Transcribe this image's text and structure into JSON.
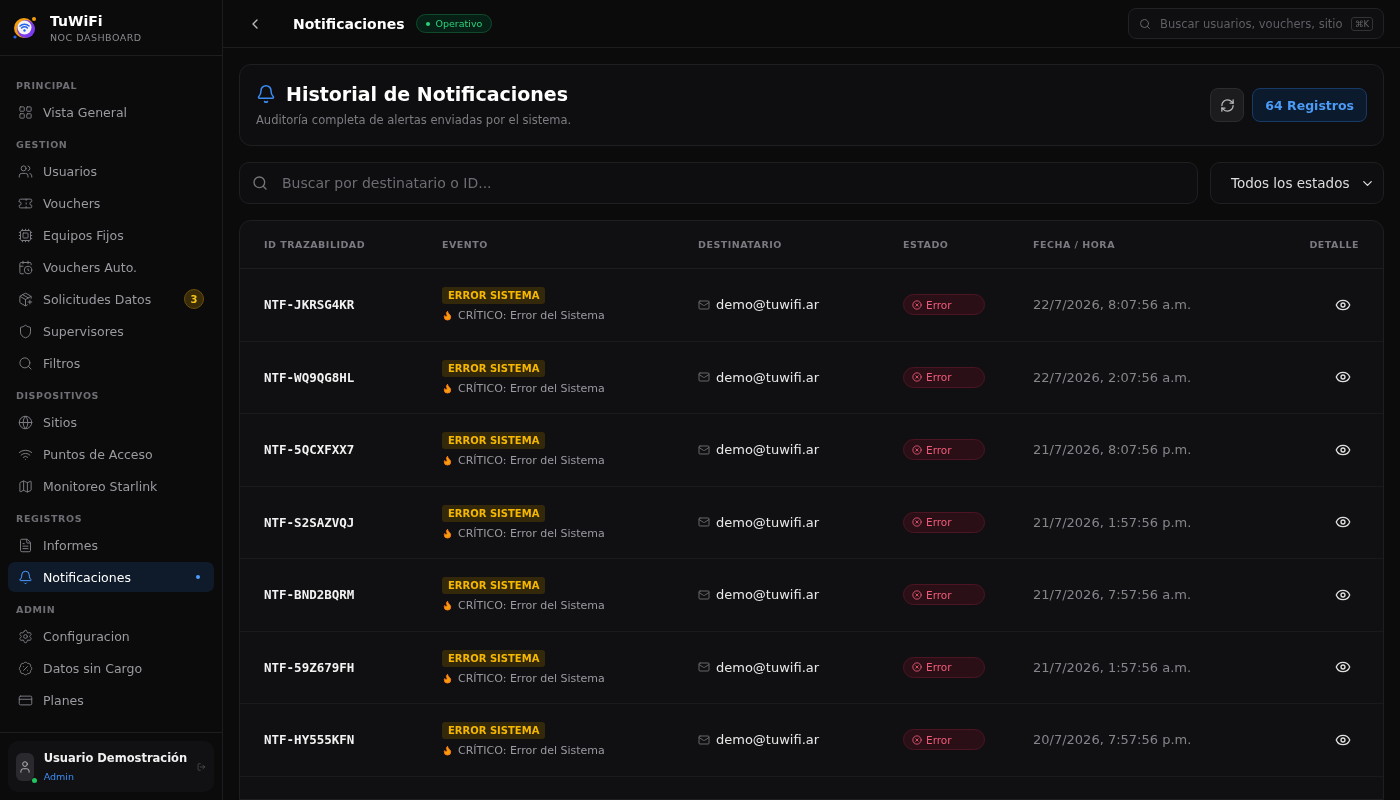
{
  "brand": {
    "name": "TuWiFi",
    "subtitle": "NOC DASHBOARD"
  },
  "sidebar": {
    "sections": [
      {
        "title": "PRINCIPAL",
        "items": [
          {
            "label": "Vista General",
            "selected": false
          }
        ]
      },
      {
        "title": "GESTION",
        "items": [
          {
            "label": "Usuarios",
            "selected": false
          },
          {
            "label": "Vouchers",
            "selected": false
          },
          {
            "label": "Equipos Fijos",
            "selected": false
          },
          {
            "label": "Vouchers Auto.",
            "selected": false
          },
          {
            "label": "Solicitudes Datos",
            "selected": false,
            "badge": "3"
          },
          {
            "label": "Supervisores",
            "selected": false
          },
          {
            "label": "Filtros",
            "selected": false
          }
        ]
      },
      {
        "title": "DISPOSITIVOS",
        "items": [
          {
            "label": "Sitios",
            "selected": false
          },
          {
            "label": "Puntos de Acceso",
            "selected": false
          },
          {
            "label": "Monitoreo Starlink",
            "selected": false
          }
        ]
      },
      {
        "title": "REGISTROS",
        "items": [
          {
            "label": "Informes",
            "selected": false
          },
          {
            "label": "Notificaciones",
            "selected": true
          }
        ]
      },
      {
        "title": "ADMIN",
        "items": [
          {
            "label": "Configuracion",
            "selected": false
          },
          {
            "label": "Datos sin Cargo",
            "selected": false
          },
          {
            "label": "Planes",
            "selected": false
          }
        ]
      }
    ],
    "user": {
      "name": "Usuario Demostración",
      "role": "Admin",
      "online": true
    }
  },
  "topbar": {
    "title": "Notificaciones",
    "status": "Operativo",
    "search": {
      "placeholder": "Buscar usuarios, vouchers, sitio",
      "shortcut": "⌘K"
    }
  },
  "header": {
    "title": "Historial de Notificaciones",
    "subtitle": "Auditoría completa de alertas enviadas por el sistema.",
    "count": "64 Registros"
  },
  "filters": {
    "search": {
      "placeholder": "Buscar por destinatario o ID..."
    },
    "status": "Todos los estados"
  },
  "table": {
    "columns": [
      "ID TRAZABILIDAD",
      "EVENTO",
      "DESTINATARIO",
      "ESTADO",
      "FECHA / HORA",
      "DETALLE"
    ],
    "rows": [
      {
        "id": "NTF-JKRSG4KR",
        "type": "ERROR SISTEMA",
        "event": "CRÍTICO: Error del Sistema",
        "recipient": "demo@tuwifi.ar",
        "status": "Error",
        "kind": "error",
        "date": "22/7/2026, 8:07:56 a.m."
      },
      {
        "id": "NTF-WQ9QG8HL",
        "type": "ERROR SISTEMA",
        "event": "CRÍTICO: Error del Sistema",
        "recipient": "demo@tuwifi.ar",
        "status": "Error",
        "kind": "error",
        "date": "22/7/2026, 2:07:56 a.m."
      },
      {
        "id": "NTF-5QCXFXX7",
        "type": "ERROR SISTEMA",
        "event": "CRÍTICO: Error del Sistema",
        "recipient": "demo@tuwifi.ar",
        "status": "Error",
        "kind": "error",
        "date": "21/7/2026, 8:07:56 p.m."
      },
      {
        "id": "NTF-S2SAZVQJ",
        "type": "ERROR SISTEMA",
        "event": "CRÍTICO: Error del Sistema",
        "recipient": "demo@tuwifi.ar",
        "status": "Error",
        "kind": "error",
        "date": "21/7/2026, 1:57:56 p.m."
      },
      {
        "id": "NTF-BND2BQRM",
        "type": "ERROR SISTEMA",
        "event": "CRÍTICO: Error del Sistema",
        "recipient": "demo@tuwifi.ar",
        "status": "Error",
        "kind": "error",
        "date": "21/7/2026, 7:57:56 a.m."
      },
      {
        "id": "NTF-59Z679FH",
        "type": "ERROR SISTEMA",
        "event": "CRÍTICO: Error del Sistema",
        "recipient": "demo@tuwifi.ar",
        "status": "Error",
        "kind": "error",
        "date": "21/7/2026, 1:57:56 a.m."
      },
      {
        "id": "NTF-HY555KFN",
        "type": "ERROR SISTEMA",
        "event": "CRÍTICO: Error del Sistema",
        "recipient": "demo@tuwifi.ar",
        "status": "Error",
        "kind": "error",
        "date": "20/7/2026, 7:57:56 p.m."
      }
    ]
  }
}
